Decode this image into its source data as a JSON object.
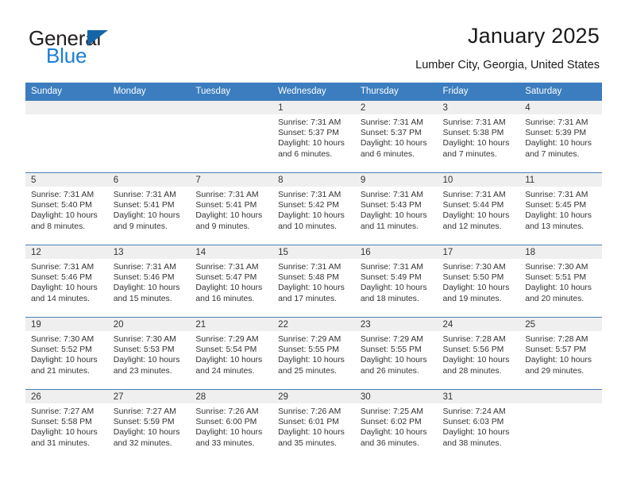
{
  "brand": {
    "name_part1": "General",
    "name_part2": "Blue",
    "triangle_color": "#1565a8",
    "blue_color": "#1a7fd4"
  },
  "header": {
    "title": "January 2025",
    "subtitle": "Lumber City, Georgia, United States"
  },
  "theme": {
    "header_row_bg": "#3b7dbf",
    "daynum_bg": "#efefef",
    "row_divider": "#4a7fb5"
  },
  "weekday_headers": [
    "Sunday",
    "Monday",
    "Tuesday",
    "Wednesday",
    "Thursday",
    "Friday",
    "Saturday"
  ],
  "weeks": [
    [
      {
        "day": "",
        "sunrise": "",
        "sunset": "",
        "daylight": ""
      },
      {
        "day": "",
        "sunrise": "",
        "sunset": "",
        "daylight": ""
      },
      {
        "day": "",
        "sunrise": "",
        "sunset": "",
        "daylight": ""
      },
      {
        "day": "1",
        "sunrise": "Sunrise: 7:31 AM",
        "sunset": "Sunset: 5:37 PM",
        "daylight": "Daylight: 10 hours and 6 minutes."
      },
      {
        "day": "2",
        "sunrise": "Sunrise: 7:31 AM",
        "sunset": "Sunset: 5:37 PM",
        "daylight": "Daylight: 10 hours and 6 minutes."
      },
      {
        "day": "3",
        "sunrise": "Sunrise: 7:31 AM",
        "sunset": "Sunset: 5:38 PM",
        "daylight": "Daylight: 10 hours and 7 minutes."
      },
      {
        "day": "4",
        "sunrise": "Sunrise: 7:31 AM",
        "sunset": "Sunset: 5:39 PM",
        "daylight": "Daylight: 10 hours and 7 minutes."
      }
    ],
    [
      {
        "day": "5",
        "sunrise": "Sunrise: 7:31 AM",
        "sunset": "Sunset: 5:40 PM",
        "daylight": "Daylight: 10 hours and 8 minutes."
      },
      {
        "day": "6",
        "sunrise": "Sunrise: 7:31 AM",
        "sunset": "Sunset: 5:41 PM",
        "daylight": "Daylight: 10 hours and 9 minutes."
      },
      {
        "day": "7",
        "sunrise": "Sunrise: 7:31 AM",
        "sunset": "Sunset: 5:41 PM",
        "daylight": "Daylight: 10 hours and 9 minutes."
      },
      {
        "day": "8",
        "sunrise": "Sunrise: 7:31 AM",
        "sunset": "Sunset: 5:42 PM",
        "daylight": "Daylight: 10 hours and 10 minutes."
      },
      {
        "day": "9",
        "sunrise": "Sunrise: 7:31 AM",
        "sunset": "Sunset: 5:43 PM",
        "daylight": "Daylight: 10 hours and 11 minutes."
      },
      {
        "day": "10",
        "sunrise": "Sunrise: 7:31 AM",
        "sunset": "Sunset: 5:44 PM",
        "daylight": "Daylight: 10 hours and 12 minutes."
      },
      {
        "day": "11",
        "sunrise": "Sunrise: 7:31 AM",
        "sunset": "Sunset: 5:45 PM",
        "daylight": "Daylight: 10 hours and 13 minutes."
      }
    ],
    [
      {
        "day": "12",
        "sunrise": "Sunrise: 7:31 AM",
        "sunset": "Sunset: 5:46 PM",
        "daylight": "Daylight: 10 hours and 14 minutes."
      },
      {
        "day": "13",
        "sunrise": "Sunrise: 7:31 AM",
        "sunset": "Sunset: 5:46 PM",
        "daylight": "Daylight: 10 hours and 15 minutes."
      },
      {
        "day": "14",
        "sunrise": "Sunrise: 7:31 AM",
        "sunset": "Sunset: 5:47 PM",
        "daylight": "Daylight: 10 hours and 16 minutes."
      },
      {
        "day": "15",
        "sunrise": "Sunrise: 7:31 AM",
        "sunset": "Sunset: 5:48 PM",
        "daylight": "Daylight: 10 hours and 17 minutes."
      },
      {
        "day": "16",
        "sunrise": "Sunrise: 7:31 AM",
        "sunset": "Sunset: 5:49 PM",
        "daylight": "Daylight: 10 hours and 18 minutes."
      },
      {
        "day": "17",
        "sunrise": "Sunrise: 7:30 AM",
        "sunset": "Sunset: 5:50 PM",
        "daylight": "Daylight: 10 hours and 19 minutes."
      },
      {
        "day": "18",
        "sunrise": "Sunrise: 7:30 AM",
        "sunset": "Sunset: 5:51 PM",
        "daylight": "Daylight: 10 hours and 20 minutes."
      }
    ],
    [
      {
        "day": "19",
        "sunrise": "Sunrise: 7:30 AM",
        "sunset": "Sunset: 5:52 PM",
        "daylight": "Daylight: 10 hours and 21 minutes."
      },
      {
        "day": "20",
        "sunrise": "Sunrise: 7:30 AM",
        "sunset": "Sunset: 5:53 PM",
        "daylight": "Daylight: 10 hours and 23 minutes."
      },
      {
        "day": "21",
        "sunrise": "Sunrise: 7:29 AM",
        "sunset": "Sunset: 5:54 PM",
        "daylight": "Daylight: 10 hours and 24 minutes."
      },
      {
        "day": "22",
        "sunrise": "Sunrise: 7:29 AM",
        "sunset": "Sunset: 5:55 PM",
        "daylight": "Daylight: 10 hours and 25 minutes."
      },
      {
        "day": "23",
        "sunrise": "Sunrise: 7:29 AM",
        "sunset": "Sunset: 5:55 PM",
        "daylight": "Daylight: 10 hours and 26 minutes."
      },
      {
        "day": "24",
        "sunrise": "Sunrise: 7:28 AM",
        "sunset": "Sunset: 5:56 PM",
        "daylight": "Daylight: 10 hours and 28 minutes."
      },
      {
        "day": "25",
        "sunrise": "Sunrise: 7:28 AM",
        "sunset": "Sunset: 5:57 PM",
        "daylight": "Daylight: 10 hours and 29 minutes."
      }
    ],
    [
      {
        "day": "26",
        "sunrise": "Sunrise: 7:27 AM",
        "sunset": "Sunset: 5:58 PM",
        "daylight": "Daylight: 10 hours and 31 minutes."
      },
      {
        "day": "27",
        "sunrise": "Sunrise: 7:27 AM",
        "sunset": "Sunset: 5:59 PM",
        "daylight": "Daylight: 10 hours and 32 minutes."
      },
      {
        "day": "28",
        "sunrise": "Sunrise: 7:26 AM",
        "sunset": "Sunset: 6:00 PM",
        "daylight": "Daylight: 10 hours and 33 minutes."
      },
      {
        "day": "29",
        "sunrise": "Sunrise: 7:26 AM",
        "sunset": "Sunset: 6:01 PM",
        "daylight": "Daylight: 10 hours and 35 minutes."
      },
      {
        "day": "30",
        "sunrise": "Sunrise: 7:25 AM",
        "sunset": "Sunset: 6:02 PM",
        "daylight": "Daylight: 10 hours and 36 minutes."
      },
      {
        "day": "31",
        "sunrise": "Sunrise: 7:24 AM",
        "sunset": "Sunset: 6:03 PM",
        "daylight": "Daylight: 10 hours and 38 minutes."
      },
      {
        "day": "",
        "sunrise": "",
        "sunset": "",
        "daylight": ""
      }
    ]
  ]
}
